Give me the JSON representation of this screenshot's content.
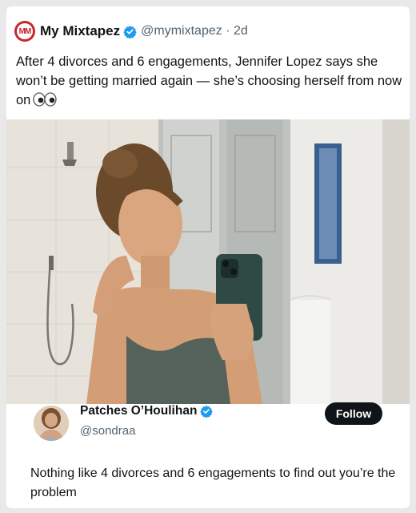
{
  "post": {
    "account_name": "My Mixtapez",
    "handle_time": "@mymixtapez · 2d",
    "logo_text": "MM",
    "text": "After 4 divorces and 6 engagements, Jennifer Lopez says she won’t be getting married again — she’s choosing herself from now on",
    "emoji_icon": "eyes-icon",
    "verified_icon": "verified-badge-icon"
  },
  "quote": {
    "account_name": "Patches O’Houlihan",
    "handle": "@sondraa",
    "follow_label": "Follow",
    "text": "Nothing like 4 divorces and 6 engagements to find out you’re the problem"
  },
  "colors": {
    "brand_red": "#c8272d",
    "verified_blue": "#1d9bf0",
    "text_primary": "#0f1419",
    "text_secondary": "#536471"
  }
}
